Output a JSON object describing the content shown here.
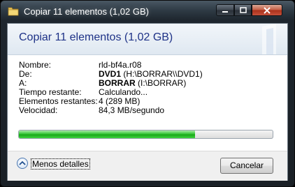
{
  "window": {
    "title": "Copiar 11 elementos (1,02 GB)"
  },
  "header": {
    "title": "Copiar 11 elementos (1,02 GB)"
  },
  "details": [
    {
      "label": "Nombre:",
      "value_bold": "",
      "value": "rld-bf4a.r08"
    },
    {
      "label": "De:",
      "value_bold": "DVD1",
      "value": " (H:\\BORRAR\\\\DVD1)"
    },
    {
      "label": "A:",
      "value_bold": "BORRAR",
      "value": " (I:\\BORRAR)"
    },
    {
      "label": "Tiempo restante:",
      "value_bold": "",
      "value": "Calculando..."
    },
    {
      "label": "Elementos restantes:",
      "value_bold": "",
      "value": "4 (289 MB)"
    },
    {
      "label": "Velocidad:",
      "value_bold": "",
      "value": "84,3 MB/segundo"
    }
  ],
  "progress": {
    "fraction": 0.695
  },
  "footer": {
    "less_details_label": "Menos detalles",
    "cancel_label": "Cancelar"
  }
}
